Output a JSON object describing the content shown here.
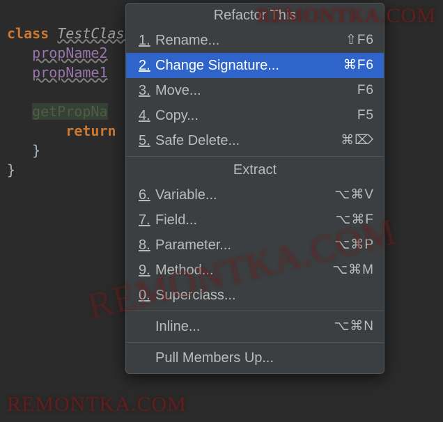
{
  "code": {
    "kw_class": "class",
    "class_name": "TestClass",
    "brace_open": " {",
    "prop2": "propName2",
    "prop1": "propName1",
    "method": "getPropNa",
    "kw_return": "return",
    "brace_close_inner": "}",
    "brace_close_outer": "}"
  },
  "popup": {
    "title": "Refactor This",
    "items_main": [
      {
        "num": "1.",
        "label": "Rename...",
        "shortcut": "⇧F6"
      },
      {
        "num": "2.",
        "label": "Change Signature...",
        "shortcut": "⌘F6",
        "selected": true
      },
      {
        "num": "3.",
        "label": "Move...",
        "shortcut": "F6"
      },
      {
        "num": "4.",
        "label": "Copy...",
        "shortcut": "F5"
      },
      {
        "num": "5.",
        "label": "Safe Delete...",
        "shortcut": "⌘⌦"
      }
    ],
    "section_extract": "Extract",
    "items_extract": [
      {
        "num": "6.",
        "label": "Variable...",
        "shortcut": "⌥⌘V"
      },
      {
        "num": "7.",
        "label": "Field...",
        "shortcut": "⌥⌘F"
      },
      {
        "num": "8.",
        "label": "Parameter...",
        "shortcut": "⌥⌘P"
      },
      {
        "num": "9.",
        "label": "Method...",
        "shortcut": "⌥⌘M"
      },
      {
        "num": "0.",
        "label": "Superclass...",
        "shortcut": ""
      }
    ],
    "items_tail": [
      {
        "num": "",
        "label": "Inline...",
        "shortcut": "⌥⌘N"
      },
      {
        "num": "",
        "label": "Pull Members Up...",
        "shortcut": ""
      }
    ]
  },
  "watermark": "REMONTKA.COM"
}
